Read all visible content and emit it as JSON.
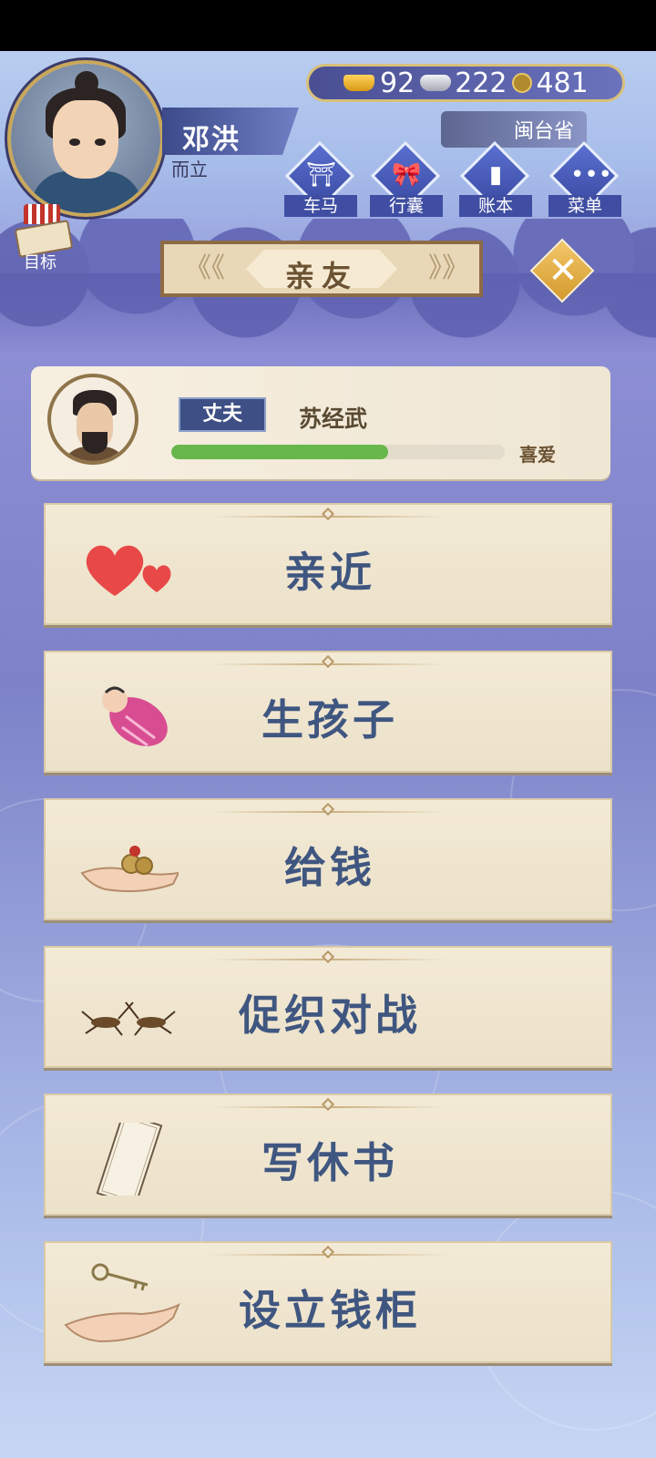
{
  "player": {
    "name": "邓洪",
    "age": "而立"
  },
  "currency": {
    "gold": "92",
    "silver": "222",
    "coins": "481"
  },
  "location": "闽台省",
  "nav": [
    {
      "label": "车马",
      "icon": "carriage-icon"
    },
    {
      "label": "行囊",
      "icon": "bundle-icon"
    },
    {
      "label": "账本",
      "icon": "ledger-icon"
    },
    {
      "label": "菜单",
      "icon": "menu-dots-icon"
    }
  ],
  "goal_label": "目标",
  "title": "亲友",
  "relative": {
    "role": "丈夫",
    "name": "苏经武",
    "affection_label": "喜爱",
    "affection_fraction": 0.65
  },
  "actions": [
    {
      "label": "亲近",
      "icon": "hearts-icon"
    },
    {
      "label": "生孩子",
      "icon": "swaddled-baby-icon"
    },
    {
      "label": "给钱",
      "icon": "hand-coins-icon"
    },
    {
      "label": "促织对战",
      "icon": "crickets-icon"
    },
    {
      "label": "写休书",
      "icon": "divorce-letter-icon"
    },
    {
      "label": "设立钱柜",
      "icon": "key-hand-icon"
    }
  ],
  "colors": {
    "accent_blue": "#3f5680",
    "affection_green": "#67b74b",
    "close_gold": "#d49a2c"
  }
}
